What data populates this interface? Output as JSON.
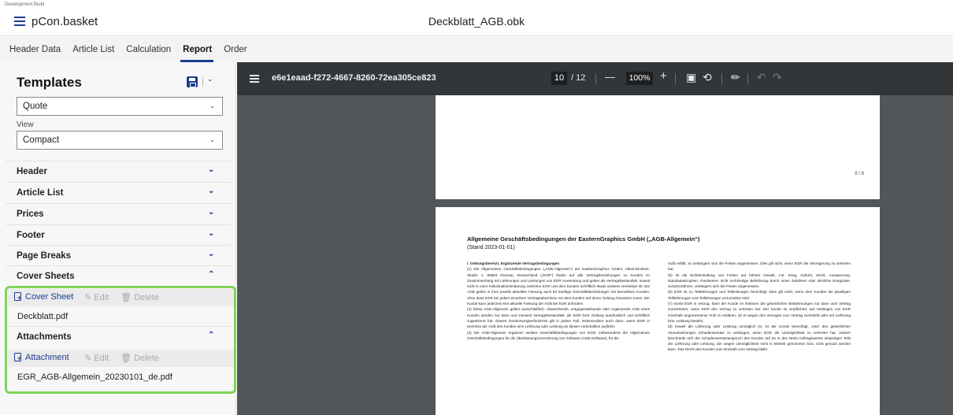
{
  "titlebar": {
    "dev_build": "Development Build",
    "app_name": "pCon.basket",
    "document_title": "Deckblatt_AGB.obk"
  },
  "tabs": [
    {
      "label": "Header Data",
      "active": false
    },
    {
      "label": "Article List",
      "active": false
    },
    {
      "label": "Calculation",
      "active": false
    },
    {
      "label": "Report",
      "active": true
    },
    {
      "label": "Order",
      "active": false
    }
  ],
  "left": {
    "templates_title": "Templates",
    "template_select": "Quote",
    "view_label": "View",
    "view_select": "Compact",
    "sections": {
      "header": "Header",
      "article_list": "Article List",
      "prices": "Prices",
      "footer": "Footer",
      "page_breaks": "Page Breaks",
      "cover_sheets": "Cover Sheets",
      "attachments": "Attachments"
    },
    "cover_toolbar": {
      "add": "Cover Sheet",
      "edit": "Edit",
      "delete": "Delete"
    },
    "cover_file": "Deckblatt.pdf",
    "attach_toolbar": {
      "add": "Attachment",
      "edit": "Edit",
      "delete": "Delete"
    },
    "attach_file": "EGR_AGB-Allgemein_20230101_de.pdf"
  },
  "viewer": {
    "doc_id": "e6e1eaad-f272-4667-8260-72ea305ce823",
    "current_page": "10",
    "total_pages": "/ 12",
    "zoom_minus": "—",
    "zoom": "100%",
    "zoom_plus": "+",
    "page1_number": "8 / 8",
    "page2": {
      "title": "Allgemeine Geschäftsbedingungen der EasternGraphics GmbH („AGB-Allgemein“)",
      "subtitle": "(Stand 2023-01-01)",
      "left_heading": "I. Geltungsbereich, Ergänzende Vertragsbedingungen",
      "left_p1": "(1) Die Allgemeinen Geschäftsbedingungen („AGB-Allgemein“) der EasternGraphics GmbH, Albert-Einstein-Straße 1, 98693 Ilmenau, Deutschland („EGR“) finden auf alle Vertragsbeziehungen zu Kunden im Zusammenhang mit Lieferungen und Leistungen von EGR Anwendung und gelten als Vertragsbestandteil, soweit nicht in einer Individualvereinbarung zwischen EGR und dem Kunden schriftlich etwas anderes vereinbart ist. Die AGB gelten in ihrer jeweils aktuellen Fassung auch für künftige Geschäftsbeziehungen mit demselben Kunden, ohne dass EGR bei jedem einzelnen Vertragsabschluss mit dem Kunden auf deren Geltung hinweisen muss. Der Kunde kann jederzeit eine aktuelle Fassung der AGB bei EGR anfordern.",
      "left_p2": "(2) Diese AGB-Allgemein gelten ausschließlich. Abweichende, entgegenstehende oder ergänzende AGB eines Kunden werden nur dann und insoweit Vertragsbestandteil, als EGR ihrer Geltung ausdrücklich und schriftlich zugestimmt hat. Dieses Zustimmungserfordernis gilt in jedem Fall, insbesondere auch dann, wenn EGR in Kenntnis der AGB des Kunden eine Lieferung oder Leistung an diesen vorbehaltlos ausführt.",
      "left_p3": "(3) Die AGB-Allgemein ergänzen weitere Geschäftsbedingungen von EGR, insbesondere die Allgemeinen Geschäftsbedingungen für die Überlassung/Lizenzierung von Software (AGB-Software), für die",
      "right_p1": "nicht erfüllt, so verlängern sich die Fristen angemessen. Dies gilt nicht, wenn EGR die Verzögerung zu vertreten hat.",
      "right_p2": "(5) Ist die Nichteinhaltung von Fristen auf höhere Gewalt, z.B. Krieg, Aufruhr, Streik, Aussperrung, Naturkatastrophen, Pandemien nicht rechtzeitige Belieferung durch einen Zulieferer oder ähnliche Ereignisse, zurückzuführen, verlängern sich die Fristen angemessen.",
      "right_p3": "(6) EGR ist zu Teillieferungen und Teilleistungen berechtigt. Dies gilt nicht, wenn dem Kunden die jeweiligen Teillieferungen und Teilleistungen unzumutbar sind.",
      "right_p4": "(7) Gerät EGR in Verzug, kann der Kunde im Rahmen der gesetzlichen Bestimmungen nur dann vom Vertrag zurücktreten, wenn EGR den Verzug zu vertreten hat. Der Kunde ist verpflichtet, auf Verlangen von EGR innerhalb angemessener Frist zu erklären, ob er wegen des Verzuges vom Vertrag zurücktritt oder auf Lieferung bzw. Leistung besteht.",
      "right_p5": "(8) Soweit die Lieferung oder Leistung unmöglich ist, ist der Kunde berechtigt, unter den gesetzlichen Voraussetzungen Schadensersatz zu verlangen, wenn EGR die Unmöglichkeit zu vertreten hat. Jedoch beschränkt sich der Schadensersatzanspruch des Kunden auf 25 % des Netto-Auftragswertes desjenigen Teils der Lieferung oder Leistung, der wegen Unmöglichkeit nicht in Betrieb genommen bzw. nicht genutzt werden kann. Das Recht des Kunden zum Rücktritt vom Vertrag bleibt"
    }
  },
  "colors": {
    "accent": "#1a3d8f",
    "highlight": "#7fd45a",
    "viewer_toolbar": "#323639",
    "viewer_bg": "#525659"
  }
}
